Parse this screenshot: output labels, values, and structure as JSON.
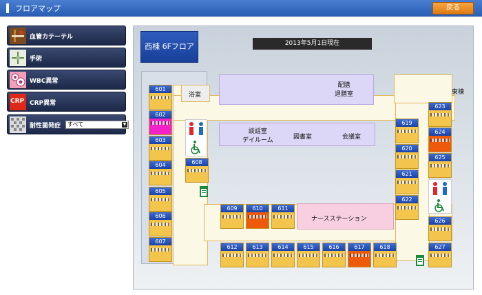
{
  "header": {
    "title": "フロアマップ",
    "back_label": "戻る"
  },
  "sidebar": {
    "items": [
      {
        "label": "血管カテーテル",
        "icon": "catheter-icon"
      },
      {
        "label": "手術",
        "icon": "surgery-icon"
      },
      {
        "label": "WBC異常",
        "icon": "wbc-icon"
      },
      {
        "label": "CRP異常",
        "icon": "crp-icon",
        "icon_text": "CRP"
      },
      {
        "label": "耐性菌発症",
        "icon": "bacteria-icon",
        "select_value": "すべて"
      }
    ]
  },
  "map": {
    "building_title": "西棟 6Fフロア",
    "date_label": "2013年5月1日現在",
    "areas": {
      "bath": "浴室",
      "nurse_station": "ナースステーション",
      "day_room": "談話室\nデイルーム",
      "library": "図書室",
      "meeting_room": "会議室",
      "dispatch_room": "配膳\n退膳室",
      "east_wing": "東棟"
    },
    "rooms": [
      {
        "number": "601",
        "status": "normal"
      },
      {
        "number": "602",
        "status": "alert-magenta"
      },
      {
        "number": "603",
        "status": "normal"
      },
      {
        "number": "604",
        "status": "normal"
      },
      {
        "number": "605",
        "status": "normal"
      },
      {
        "number": "606",
        "status": "normal"
      },
      {
        "number": "607",
        "status": "normal"
      },
      {
        "number": "608",
        "status": "normal"
      },
      {
        "number": "609",
        "status": "normal"
      },
      {
        "number": "610",
        "status": "alert-red"
      },
      {
        "number": "611",
        "status": "normal"
      },
      {
        "number": "612",
        "status": "normal"
      },
      {
        "number": "613",
        "status": "normal"
      },
      {
        "number": "614",
        "status": "normal"
      },
      {
        "number": "615",
        "status": "normal"
      },
      {
        "number": "616",
        "status": "normal"
      },
      {
        "number": "617",
        "status": "alert-red"
      },
      {
        "number": "618",
        "status": "normal"
      },
      {
        "number": "619",
        "status": "normal"
      },
      {
        "number": "620",
        "status": "normal"
      },
      {
        "number": "621",
        "status": "normal"
      },
      {
        "number": "622",
        "status": "normal"
      },
      {
        "number": "623",
        "status": "normal"
      },
      {
        "number": "624",
        "status": "alert-red"
      },
      {
        "number": "625",
        "status": "normal"
      },
      {
        "number": "626",
        "status": "normal"
      },
      {
        "number": "627",
        "status": "normal"
      }
    ]
  },
  "colors": {
    "room_normal": "#f4c54c",
    "alert_red": "#ee5a0c",
    "alert_magenta": "#f321c8",
    "header_blue": "#2a5fb4",
    "back_orange": "#e07a10"
  }
}
